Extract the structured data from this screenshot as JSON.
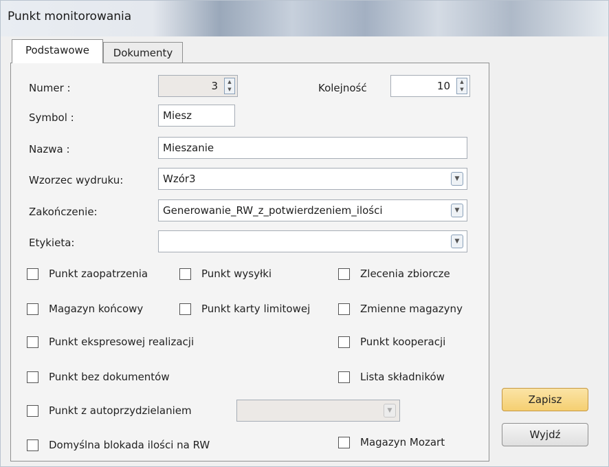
{
  "window": {
    "title": "Punkt monitorowania"
  },
  "tabs": [
    {
      "label": "Podstawowe",
      "active": true
    },
    {
      "label": "Dokumenty",
      "active": false
    }
  ],
  "form": {
    "numer": {
      "label": "Numer :",
      "value": "3",
      "disabled": true
    },
    "kolejnosc": {
      "label": "Kolejność",
      "value": "10"
    },
    "symbol": {
      "label": "Symbol :",
      "value": "Miesz"
    },
    "nazwa": {
      "label": "Nazwa :",
      "value": "Mieszanie"
    },
    "wzorzec": {
      "label": "Wzorzec wydruku:",
      "value": "Wzór3"
    },
    "zakonczenie": {
      "label": "Zakończenie:",
      "value": "Generowanie_RW_z_potwierdzeniem_ilości"
    },
    "etykieta": {
      "label": "Etykieta:",
      "value": ""
    },
    "autoprzydzial_select": {
      "value": "",
      "disabled": true
    }
  },
  "checkboxes": {
    "punkt_zaopatrzenia": {
      "label": "Punkt zaopatrzenia",
      "checked": false
    },
    "punkt_wysylki": {
      "label": "Punkt wysyłki",
      "checked": false
    },
    "zlecenia_zbiorcze": {
      "label": "Zlecenia zbiorcze",
      "checked": false
    },
    "magazyn_koncowy": {
      "label": "Magazyn końcowy",
      "checked": false
    },
    "punkt_karty_limitowej": {
      "label": "Punkt karty limitowej",
      "checked": false
    },
    "zmienne_magazyny": {
      "label": "Zmienne magazyny",
      "checked": false
    },
    "punkt_ekspresowej": {
      "label": "Punkt ekspresowej realizacji",
      "checked": false
    },
    "punkt_kooperacji": {
      "label": "Punkt kooperacji",
      "checked": false
    },
    "punkt_bez_dokumentow": {
      "label": "Punkt bez dokumentów",
      "checked": false
    },
    "lista_skladnikow": {
      "label": "Lista składników",
      "checked": false
    },
    "punkt_autoprzydzial": {
      "label": "Punkt z autoprzydzielaniem",
      "checked": false
    },
    "domyslna_blokada": {
      "label": "Domyślna blokada ilości na RW",
      "checked": false
    },
    "magazyn_mozart": {
      "label": "Magazyn Mozart",
      "checked": false
    }
  },
  "buttons": {
    "save": "Zapisz",
    "exit": "Wyjdź"
  },
  "icons": {
    "spin_up": "▲",
    "spin_down": "▼",
    "dropdown": "▼"
  },
  "colors": {
    "save_button": "#f5cf71",
    "panel_bg": "#f4f4f4",
    "field_border": "#a5acb5"
  }
}
